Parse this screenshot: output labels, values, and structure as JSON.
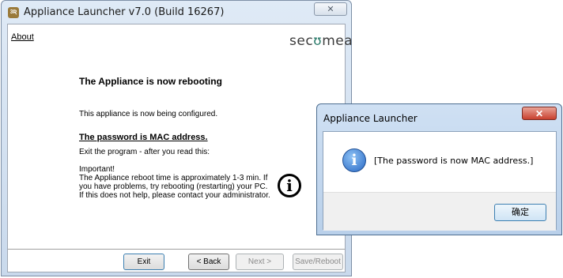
{
  "main_window": {
    "title": "Appliance Launcher v7.0 (Build 16267)",
    "app_icon_text": "3Ʀ",
    "close_symbol": "✕",
    "about_link": "About",
    "brand": {
      "pre": "sec",
      "mid": "ʊ",
      "post": "mea"
    },
    "heading": "The Appliance is now rebooting",
    "configured_text": "This appliance is now being configured.",
    "password_text": "The password is MAC address.",
    "exit_text": "Exit the program - after you read this:",
    "important_text": "Important!\nThe Appliance reboot time is approximately 1-3 min. If\nyou have problems, try rebooting (restarting) your PC.\nIf this does not help, please contact your administrator.",
    "info_glyph": "i",
    "buttons": {
      "exit": "Exit",
      "back": "< Back",
      "next": "Next >",
      "save_reboot": "Save/Reboot"
    }
  },
  "dialog": {
    "title": "Appliance Launcher",
    "close_symbol": "✕",
    "info_glyph": "i",
    "message": "[The password is now MAC address.]",
    "ok_button": "确定"
  }
}
